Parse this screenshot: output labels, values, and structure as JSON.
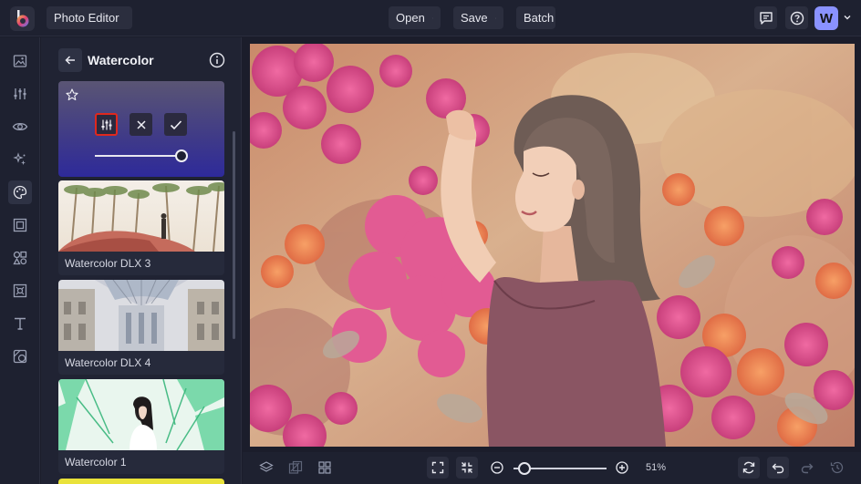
{
  "topbar": {
    "app_menu_label": "Photo Editor",
    "open_label": "Open",
    "save_label": "Save",
    "batch_label": "Batch",
    "avatar_initial": "W"
  },
  "rail": {
    "items": [
      "image-icon",
      "adjust-icon",
      "eye-icon",
      "magic-icon",
      "palette-icon",
      "frame-icon",
      "graphics-icon",
      "texture-icon",
      "text-icon",
      "overlay-icon"
    ],
    "active_index": 4
  },
  "panel": {
    "title": "Watercolor",
    "filters": [
      {
        "label": "Watercolor DLX 3"
      },
      {
        "label": "Watercolor DLX 4"
      },
      {
        "label": "Watercolor 1"
      }
    ],
    "intensity": 1.0
  },
  "bottombar": {
    "zoom_label": "51%",
    "zoom_fraction": 0.1
  },
  "colors": {
    "accent": "#8a92ff",
    "selected_border": "#e0281e",
    "background": "#1b1d2b"
  }
}
